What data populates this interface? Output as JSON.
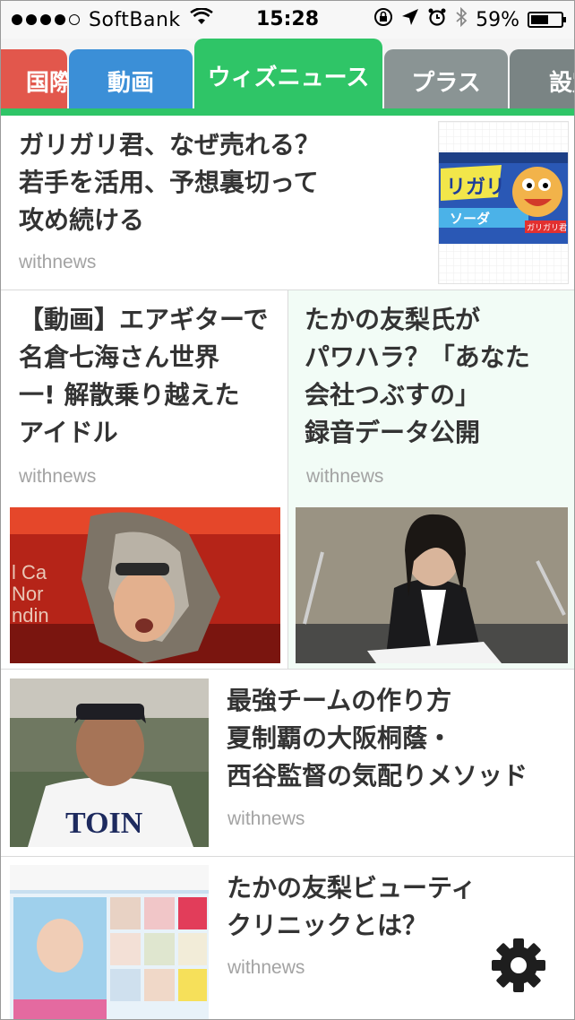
{
  "status_bar": {
    "carrier": "SoftBank",
    "time": "15:28",
    "battery_percent": "59%",
    "battery_level": 0.59,
    "signal_bars": 4
  },
  "tabs": [
    {
      "label": "国際",
      "color": "#e2574c"
    },
    {
      "label": "動画",
      "color": "#3b8fd7"
    },
    {
      "label": "ウィズニュース",
      "color": "#2fc567",
      "active": true
    },
    {
      "label": "プラス",
      "color": "#8a9494"
    },
    {
      "label": "設定",
      "color": "#7a8484"
    }
  ],
  "articles": [
    {
      "headline_lines": [
        "ガリガリ君、なぜ売れる？",
        "若手を活用、予想裏切って",
        "攻め続ける"
      ],
      "source": "withnews",
      "image_text": "ガリガリ君 ソーダ"
    },
    {
      "headline_lines": [
        "【動画】エアギターで",
        "名倉七海さん世界",
        "一! 解散乗り越えた",
        "アイドル"
      ],
      "source": "withnews"
    },
    {
      "headline_lines": [
        "たかの友梨氏が",
        "パワハラ？「あなた",
        "会社つぶすの」",
        "録音データ公開"
      ],
      "source": "withnews"
    },
    {
      "headline_lines": [
        "最強チームの作り方",
        "夏制覇の大阪桐蔭・",
        "西谷監督の気配りメソッド"
      ],
      "source": "withnews",
      "image_text": "TOIN"
    },
    {
      "headline_lines": [
        "たかの友梨ビューティ",
        "クリニックとは？"
      ],
      "source": "withnews"
    }
  ],
  "settings_icon": "gear-icon"
}
